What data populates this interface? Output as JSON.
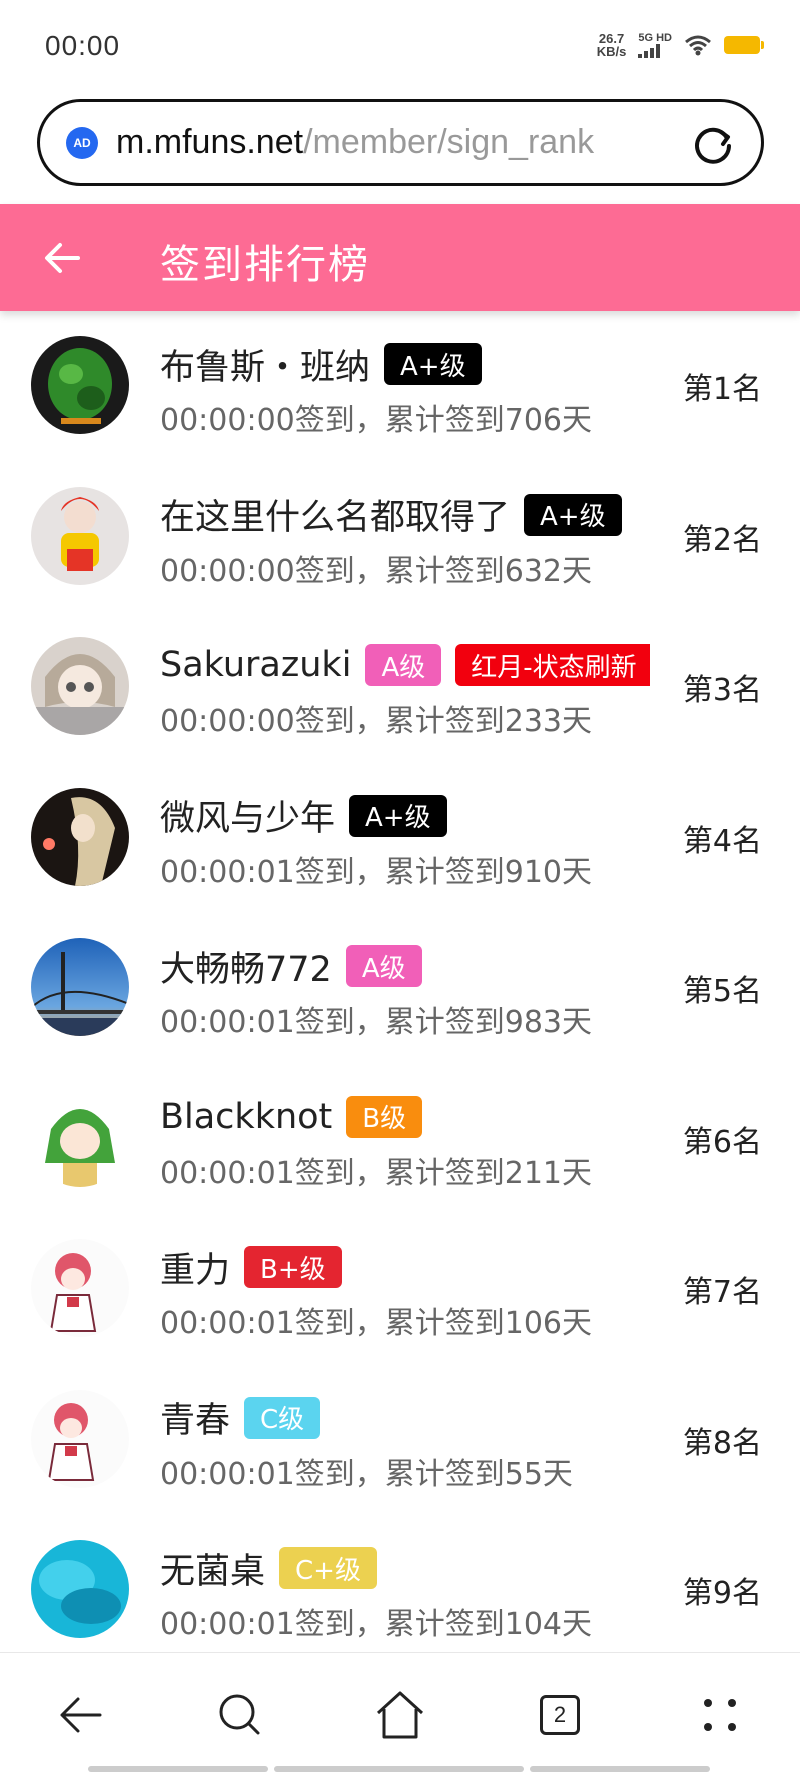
{
  "status_bar": {
    "time": "00:00",
    "net_speed_value": "26.7",
    "net_speed_unit": "KB/s",
    "network_type": "5G HD",
    "battery_color": "#f5b800"
  },
  "address_bar": {
    "ad_label": "AD",
    "url_host": "m.mfuns.net",
    "url_path": "/member/sign_rank"
  },
  "header": {
    "title": "签到排行榜",
    "background_color": "#fd6b94"
  },
  "rankings": [
    {
      "name": "布鲁斯・班纳",
      "badges": [
        {
          "label": "A+级",
          "color": "#000000"
        }
      ],
      "info": "00:00:00签到，累计签到706天",
      "rank": "第1名"
    },
    {
      "name": "在这里什么名都取得了",
      "badges": [
        {
          "label": "A+级",
          "color": "#000000"
        }
      ],
      "info": "00:00:00签到，累计签到632天",
      "rank": "第2名"
    },
    {
      "name": "Sakurazuki",
      "badges": [
        {
          "label": "A级",
          "color": "#f15fb8"
        },
        {
          "label": "红月-状态刷新",
          "color": "#f2000e"
        }
      ],
      "info": "00:00:00签到，累计签到233天",
      "rank": "第3名"
    },
    {
      "name": "微风与少年",
      "badges": [
        {
          "label": "A+级",
          "color": "#000000"
        }
      ],
      "info": "00:00:01签到，累计签到910天",
      "rank": "第4名"
    },
    {
      "name": "大畅畅772",
      "badges": [
        {
          "label": "A级",
          "color": "#f15fb8"
        }
      ],
      "info": "00:00:01签到，累计签到983天",
      "rank": "第5名"
    },
    {
      "name": "Blackknot",
      "badges": [
        {
          "label": "B级",
          "color": "#f98d0e"
        }
      ],
      "info": "00:00:01签到，累计签到211天",
      "rank": "第6名"
    },
    {
      "name": "重力",
      "badges": [
        {
          "label": "B+级",
          "color": "#e42530"
        }
      ],
      "info": "00:00:01签到，累计签到106天",
      "rank": "第7名"
    },
    {
      "name": "青春",
      "badges": [
        {
          "label": "C级",
          "color": "#5bd4ef"
        }
      ],
      "info": "00:00:01签到，累计签到55天",
      "rank": "第8名"
    },
    {
      "name": "无菌桌",
      "badges": [
        {
          "label": "C+级",
          "color": "#ecd150"
        }
      ],
      "info": "00:00:01签到，累计签到104天",
      "rank": "第9名"
    }
  ],
  "bottom_nav": {
    "items": [
      "back-icon",
      "search-icon",
      "home-icon",
      "tabs-icon",
      "menu-icon"
    ],
    "tab_count": "2"
  }
}
